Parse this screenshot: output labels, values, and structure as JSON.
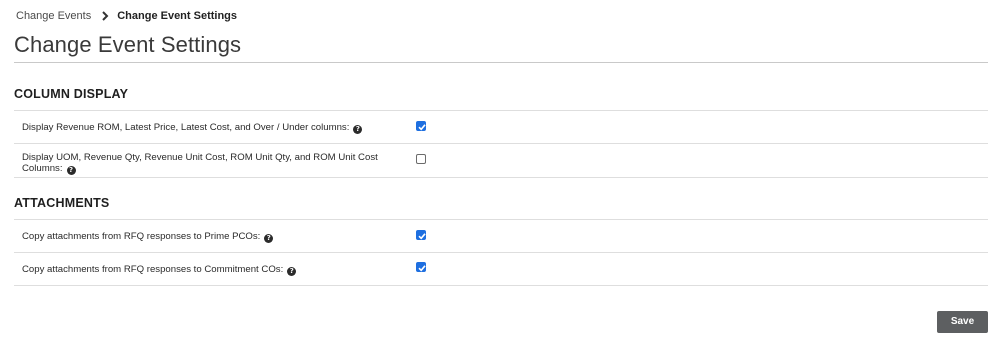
{
  "breadcrumb": {
    "parent": "Change Events",
    "current": "Change Event Settings"
  },
  "page_title": "Change Event Settings",
  "sections": [
    {
      "heading": "COLUMN DISPLAY",
      "rows": [
        {
          "label": "Display Revenue ROM, Latest Price, Latest Cost, and Over / Under columns:",
          "checked": true
        },
        {
          "label_line1": "Display UOM, Revenue Qty, Revenue Unit Cost, ROM Unit Qty, and ROM Unit Cost",
          "label_line2": "Columns:",
          "checked": false
        }
      ]
    },
    {
      "heading": "ATTACHMENTS",
      "rows": [
        {
          "label": "Copy attachments from RFQ responses to Prime PCOs:",
          "checked": true
        },
        {
          "label": "Copy attachments from RFQ responses to Commitment COs:",
          "checked": true
        }
      ]
    }
  ],
  "help_glyph": "?",
  "icons": {
    "help": "question-circle-icon",
    "separator": "chevron-right-icon",
    "check": "checkmark-icon"
  },
  "colors": {
    "checkbox_accent": "#1e6fe0",
    "save_button_bg": "#5d5f61"
  },
  "actions": {
    "save_label": "Save"
  }
}
